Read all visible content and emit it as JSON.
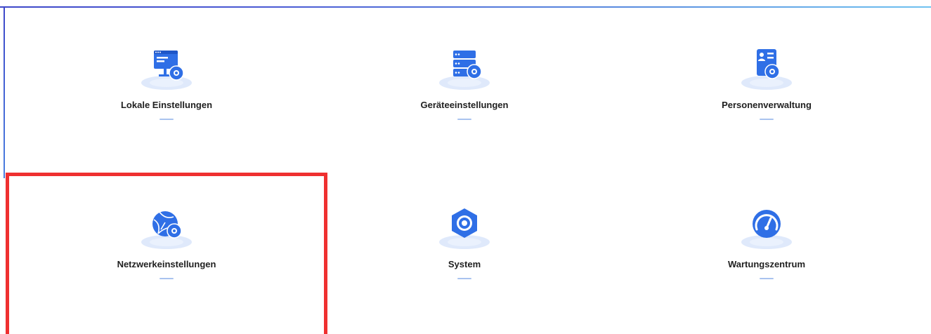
{
  "tiles": [
    {
      "id": "local",
      "label": "Lokale Einstellungen",
      "icon": "monitor-gear-icon"
    },
    {
      "id": "device",
      "label": "Geräteeinstellungen",
      "icon": "server-gear-icon"
    },
    {
      "id": "person",
      "label": "Personenverwaltung",
      "icon": "id-card-gear-icon"
    },
    {
      "id": "network",
      "label": "Netzwerkeinstellungen",
      "icon": "globe-gear-icon"
    },
    {
      "id": "system",
      "label": "System",
      "icon": "hexagon-gear-icon"
    },
    {
      "id": "maintenance",
      "label": "Wartungszentrum",
      "icon": "speedometer-icon"
    }
  ],
  "colors": {
    "accent": "#2f6fe6",
    "accent_light": "#a9c3ef",
    "platform": "#dfe9fb",
    "highlight": "#ef3030",
    "text": "#1f1f1f"
  },
  "selected_tile": "network"
}
